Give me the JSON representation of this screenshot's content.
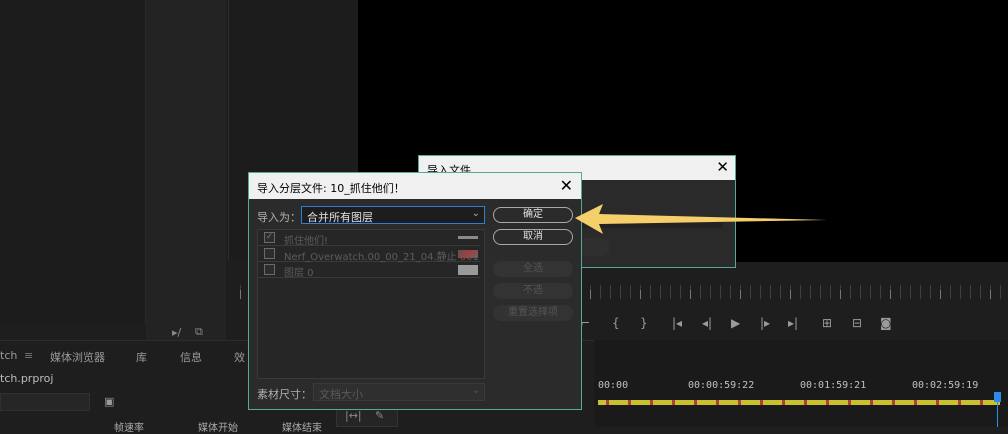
{
  "background": {
    "tabs": [
      "tch",
      "媒体浏览器",
      "库",
      "信息",
      "效"
    ],
    "project_file": "tch.prproj",
    "columns": [
      "帧速率",
      "媒体开始",
      "媒体结束"
    ],
    "timecodes": [
      "00:00",
      "00:00:59:22",
      "00:01:59:21",
      "00:02:59:19"
    ]
  },
  "back_dialog": {
    "title": "导入文件",
    "close": "✕"
  },
  "dialog": {
    "title": "导入分层文件: 10_抓住他们！",
    "close": "✕",
    "import_label": "导入为：",
    "import_value": "合并所有图层",
    "layers": [
      {
        "name": "抓住他们!",
        "checked": true
      },
      {
        "name": "Nerf_Overwatch.00_00_21_04.静止 001",
        "checked": false
      },
      {
        "name": "图层 0",
        "checked": false
      }
    ],
    "ok": "确定",
    "cancel": "取消",
    "select_all": "全选",
    "select_none": "不选",
    "reset": "重置选择项",
    "size_label": "素材尺寸：",
    "size_value": "文档大小"
  },
  "colors": {
    "accent_border": "#55a89a",
    "focus_blue": "#2f7fd3",
    "arrow": "#f5cf6a"
  }
}
